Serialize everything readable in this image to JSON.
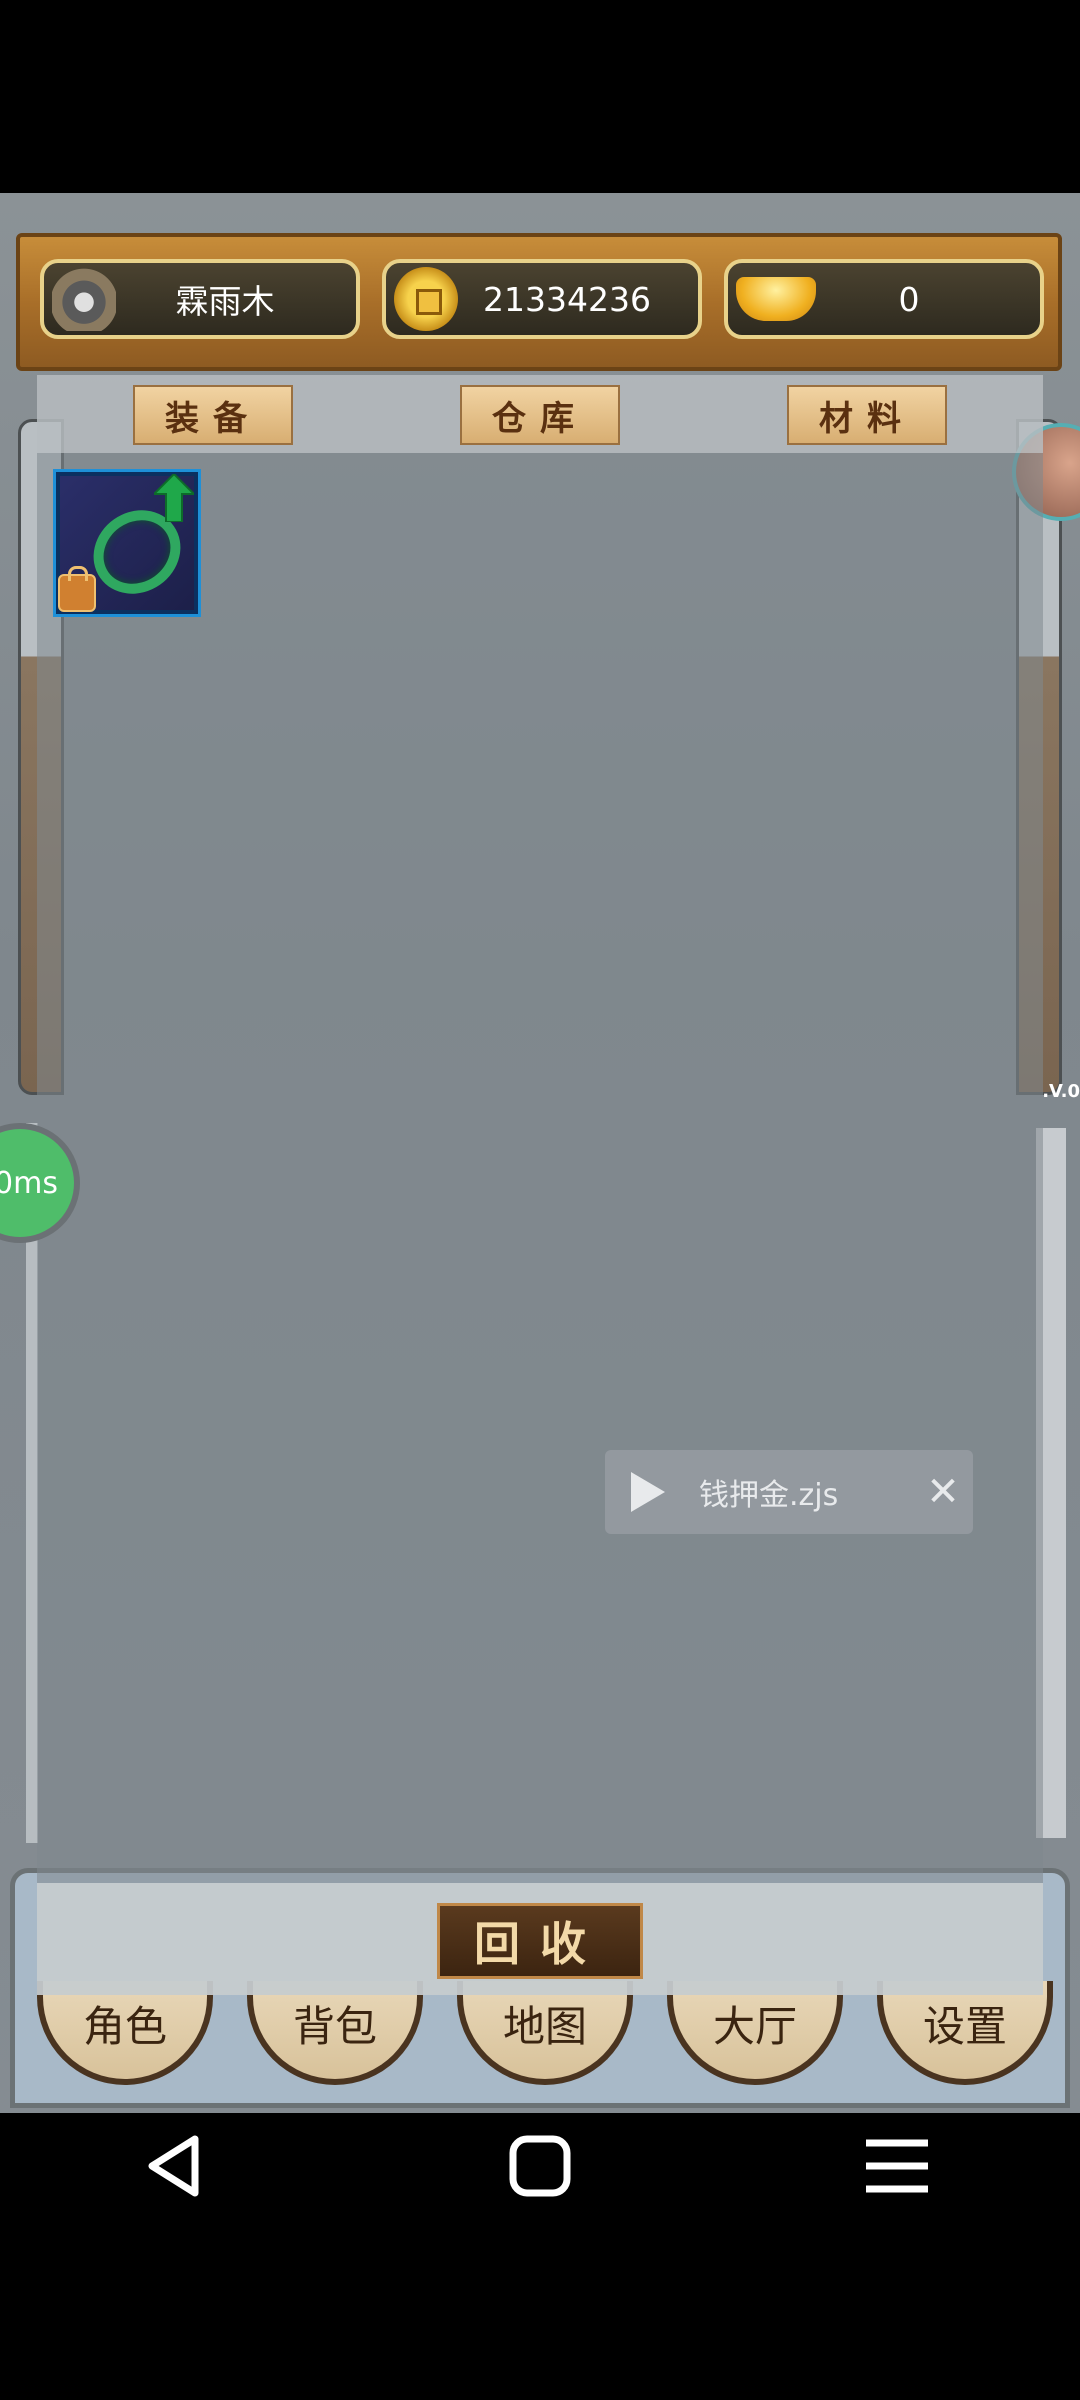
{
  "header": {
    "player_name": "霖雨木",
    "coins": "21334236",
    "ingots": "0"
  },
  "tabs": [
    {
      "label": "装备"
    },
    {
      "label": "仓库"
    },
    {
      "label": "材料"
    }
  ],
  "inventory": {
    "items": [
      {
        "icon": "jade-ring-icon",
        "upgrade": true,
        "locked": true
      }
    ]
  },
  "overlay": {
    "latency": "0ms",
    "version_fragment": ".V.0",
    "toast_label": "钱押金.zjs"
  },
  "actions": {
    "recycle_label": "回收"
  },
  "bottom_nav": [
    {
      "label": "角色"
    },
    {
      "label": "背包"
    },
    {
      "label": "地图"
    },
    {
      "label": "大厅"
    },
    {
      "label": "设置"
    }
  ],
  "colors": {
    "accent_gold": "#e8d28a",
    "wood": "#a96f29",
    "latency_green": "#4fbd6a",
    "slot_border": "#1e90d8"
  }
}
